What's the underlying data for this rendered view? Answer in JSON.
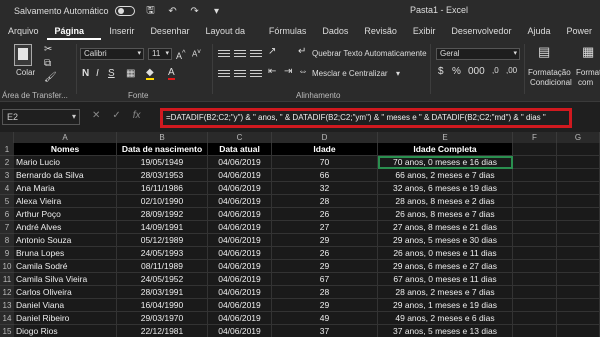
{
  "titlebar": {
    "autosave": "Salvamento Automático",
    "title": "Pasta1 - Excel"
  },
  "tabs": [
    "Arquivo",
    "Página Inicial",
    "Inserir",
    "Desenhar",
    "Layout da Página",
    "Fórmulas",
    "Dados",
    "Revisão",
    "Exibir",
    "Desenvolvedor",
    "Ajuda",
    "Power"
  ],
  "ribbon": {
    "paste": "Colar",
    "clipboard": "Área de Transfer...",
    "font_name": "Calibri",
    "font_size": "11",
    "font_group": "Fonte",
    "wrap": "Quebrar Texto Automaticamente",
    "merge": "Mesclar e Centralizar",
    "align_group": "Alinhamento",
    "number_format": "Geral",
    "cond_format_1": "Formatação",
    "cond_format_2": "Condicional",
    "format_as_1": "Format",
    "format_as_2": "com"
  },
  "formula_bar": {
    "name_box": "E2",
    "formula": "=DATADIF(B2;C2;\"y\") & \" anos, \" & DATADIF(B2;C2;\"ym\") & \" meses e \" & DATADIF(B2;C2;\"md\") & \" dias \""
  },
  "columns": [
    "A",
    "B",
    "C",
    "D",
    "E",
    "F",
    "G"
  ],
  "headers": [
    "Nomes",
    "Data de nascimento",
    "Data atual",
    "Idade",
    "Idade Completa"
  ],
  "rows": [
    [
      "Mario Lucio",
      "19/05/1949",
      "04/06/2019",
      "70",
      "70 anos, 0 meses e 16 dias"
    ],
    [
      "Bernardo da Silva",
      "28/03/1953",
      "04/06/2019",
      "66",
      "66 anos, 2 meses e 7 dias"
    ],
    [
      "Ana Maria",
      "16/11/1986",
      "04/06/2019",
      "32",
      "32 anos, 6 meses e 19 dias"
    ],
    [
      "Alexa Vieira",
      "02/10/1990",
      "04/06/2019",
      "28",
      "28 anos, 8 meses e 2 dias"
    ],
    [
      "Arthur Poço",
      "28/09/1992",
      "04/06/2019",
      "26",
      "26 anos, 8 meses e 7 dias"
    ],
    [
      "André Alves",
      "14/09/1991",
      "04/06/2019",
      "27",
      "27 anos, 8 meses e 21 dias"
    ],
    [
      "Antonio Souza",
      "05/12/1989",
      "04/06/2019",
      "29",
      "29 anos, 5 meses e 30 dias"
    ],
    [
      "Bruna  Lopes",
      "24/05/1993",
      "04/06/2019",
      "26",
      "26 anos, 0 meses e 11 dias"
    ],
    [
      "Camila Sodré",
      "08/11/1989",
      "04/06/2019",
      "29",
      "29 anos, 6 meses e 27 dias"
    ],
    [
      "Camila  Silva Vieira",
      "24/05/1952",
      "04/06/2019",
      "67",
      "67 anos, 0 meses e 11 dias"
    ],
    [
      "Carlos Oliveira",
      "28/03/1991",
      "04/06/2019",
      "28",
      "28 anos, 2 meses e 7 dias"
    ],
    [
      "Daniel Viana",
      "16/04/1990",
      "04/06/2019",
      "29",
      "29 anos, 1 meses e 19 dias"
    ],
    [
      "Daniel Ribeiro",
      "29/03/1970",
      "04/06/2019",
      "49",
      "49 anos, 2 meses e 6 dias"
    ],
    [
      "Diogo Rios",
      "22/12/1981",
      "04/06/2019",
      "37",
      "37 anos, 5 meses e 13 dias"
    ]
  ],
  "row_numbers": [
    "1",
    "2",
    "3",
    "4",
    "5",
    "6",
    "7",
    "8",
    "9",
    "10",
    "11",
    "12",
    "13",
    "14",
    "15"
  ]
}
